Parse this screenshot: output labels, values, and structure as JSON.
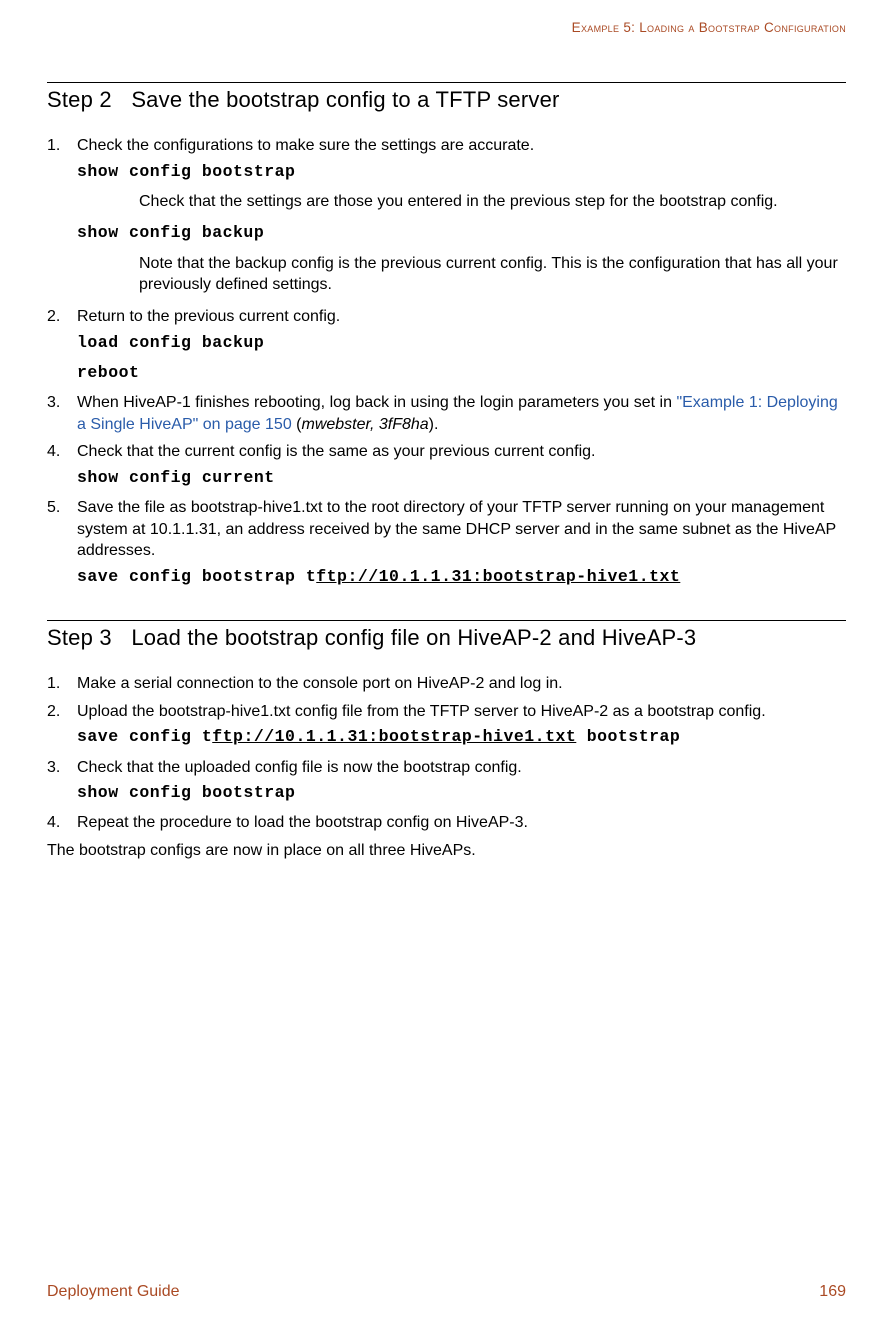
{
  "header": {
    "running_title": "Example 5: Loading a Bootstrap Configuration"
  },
  "step2": {
    "number": "Step 2",
    "title": "Save the bootstrap config to a TFTP server",
    "i1": {
      "text": "Check the configurations to make sure the settings are accurate.",
      "cmd1": "show config bootstrap",
      "sub1": "Check that the settings are those you entered in the previous step for the bootstrap config.",
      "cmd2": "show config backup",
      "sub2": "Note that the backup config is the previous current config. This is the configuration that has all your previously defined settings."
    },
    "i2": {
      "text": "Return to the previous current config.",
      "cmd1": "load config backup",
      "cmd2": "reboot"
    },
    "i3": {
      "pre": "When HiveAP-1 finishes rebooting, log back in using the login parameters you set in ",
      "link": "\"Example 1: Deploying a Single HiveAP\" on page 150",
      "paren_open": " (",
      "cred": "mwebster, 3fF8ha",
      "paren_close": ")."
    },
    "i4": {
      "text": "Check that the current config is the same as your previous current config.",
      "cmd1": "show config current"
    },
    "i5": {
      "text": "Save the file as bootstrap-hive1.txt to the root directory of your TFTP server running on your management system at 10.1.1.31, an address received by the same DHCP server and in the same subnet as the HiveAP addresses.",
      "cmd_prefix": "save config bootstrap t",
      "cmd_underline": "ftp://10.1.1.31:bootstrap-hive1.txt"
    }
  },
  "step3": {
    "number": "Step 3",
    "title": "Load the bootstrap config file on HiveAP-2 and HiveAP-3",
    "i1": {
      "text": "Make a serial connection to the console port on HiveAP-2 and log in."
    },
    "i2": {
      "text": "Upload the bootstrap-hive1.txt config file from the TFTP server to HiveAP-2 as a bootstrap config.",
      "cmd_prefix": "save config t",
      "cmd_underline": "ftp://10.1.1.31:bootstrap-hive1.txt",
      "cmd_suffix": " bootstrap"
    },
    "i3": {
      "text": "Check that the uploaded config file is now the bootstrap config.",
      "cmd1": "show config bootstrap"
    },
    "i4": {
      "text": "Repeat the procedure to load the bootstrap config on HiveAP-3."
    },
    "closing": "The bootstrap configs are now in place on all three HiveAPs."
  },
  "footer": {
    "doc_title": "Deployment Guide",
    "page_no": "169"
  }
}
